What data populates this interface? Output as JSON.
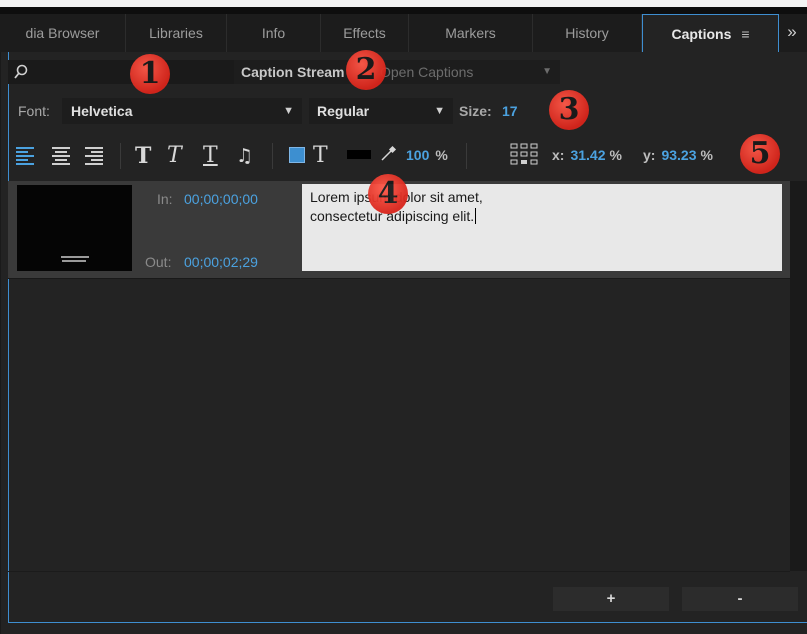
{
  "tabs": [
    {
      "label": "dia Browser"
    },
    {
      "label": "Libraries"
    },
    {
      "label": "Info"
    },
    {
      "label": "Effects"
    },
    {
      "label": "Markers"
    },
    {
      "label": "History"
    },
    {
      "label": "Captions"
    }
  ],
  "tab_menu_glyph": "≡",
  "overflow_glyph": "»",
  "toolbar": {
    "stream_label": "Caption Stream",
    "stream_value": "Open Captions",
    "font_label": "Font:",
    "font_value": "Helvetica",
    "style_value": "Regular",
    "size_label": "Size:",
    "size_value": "17",
    "opacity_value": "100",
    "opacity_unit": "%",
    "x_label": "x:",
    "x_value": "31.42",
    "x_unit": "%",
    "y_label": "y:",
    "y_value": "93.23",
    "y_unit": "%",
    "bold_glyph": "T",
    "italic_glyph": "T",
    "underline_glyph": "T",
    "text_glyph": "T",
    "music_glyph": "♫"
  },
  "caption": {
    "in_label": "In:",
    "in_time": "00;00;00;00",
    "out_label": "Out:",
    "out_time": "00;00;02;29",
    "text": "Lorem ipsum dolor sit amet,\nconsectetur adipiscing elit."
  },
  "buttons": {
    "add": "+",
    "remove": "-"
  },
  "callouts": [
    "1",
    "2",
    "3",
    "4",
    "5"
  ],
  "colors": {
    "accent": "#4ba2e0",
    "callout": "#e0281d",
    "panel_bg": "#232323"
  }
}
